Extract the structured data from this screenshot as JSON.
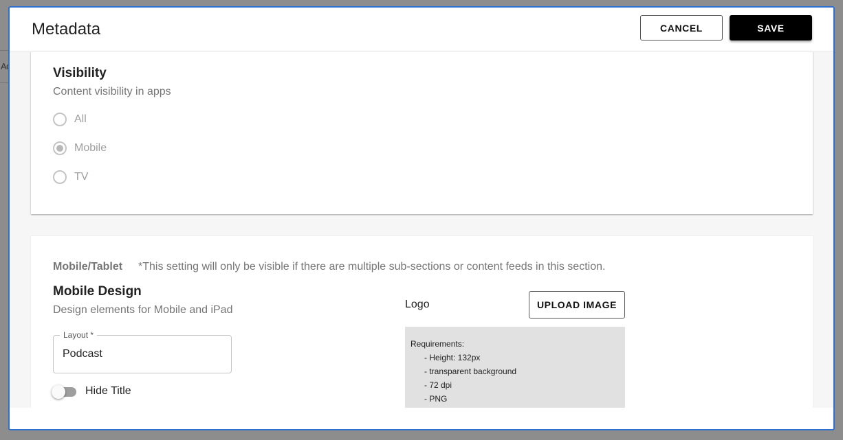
{
  "backdrop": {
    "text": "Ad"
  },
  "dialog": {
    "title": "Metadata",
    "cancel_label": "CANCEL",
    "save_label": "SAVE"
  },
  "visibility": {
    "title": "Visibility",
    "subtitle": "Content visibility in apps",
    "options": [
      {
        "label": "All",
        "checked": false
      },
      {
        "label": "Mobile",
        "checked": true
      },
      {
        "label": "TV",
        "checked": false
      }
    ],
    "selected": "Mobile"
  },
  "mobile": {
    "tag": "Mobile/Tablet",
    "note": "*This setting will only be visible if there are multiple sub-sections or content feeds in this section.",
    "title": "Mobile Design",
    "subtitle": "Design elements for Mobile and iPad",
    "layout_label": "Layout *",
    "layout_value": "Podcast",
    "hide_title_label": "Hide Title",
    "hide_title_on": false,
    "logo_label": "Logo",
    "upload_label": "UPLOAD IMAGE",
    "requirements_title": "Requirements:",
    "requirements": [
      "- Height: 132px",
      "- transparent background",
      "- 72 dpi",
      "- PNG"
    ]
  },
  "colors": {
    "dialog_border": "#2d6fcf",
    "save_bg": "#000000",
    "requirements_bg": "#e1e1e1"
  }
}
